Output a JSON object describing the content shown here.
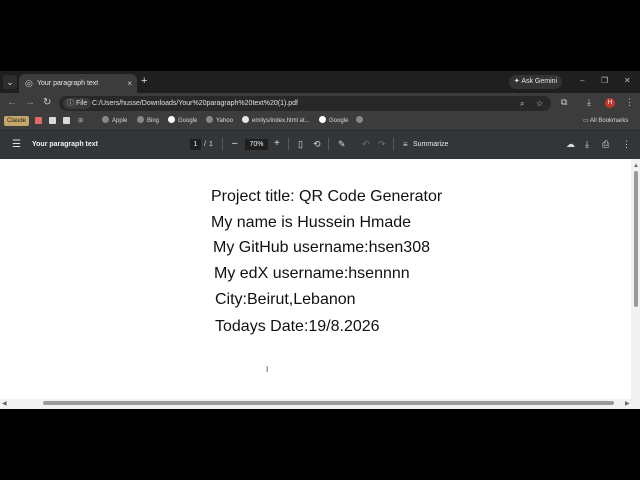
{
  "tabstrip": {
    "tab_title": "Your paragraph text",
    "close_glyph": "×",
    "new_tab_glyph": "+",
    "gemini_label": "Ask Gemini",
    "window_controls": [
      "–",
      "❐",
      "✕"
    ]
  },
  "toolbar": {
    "back_glyph": "←",
    "forward_glyph": "→",
    "reload_glyph": "↻",
    "file_chip": "File",
    "url": "C:/Users/husse/Downloads/Your%20paragraph%20text%20(1).pdf",
    "profile_initial": "H"
  },
  "bookmarks": {
    "claude": "Claude",
    "items": [
      {
        "label": "Apple",
        "icon": "apple-icon"
      },
      {
        "label": "Bing",
        "icon": "bing-icon"
      },
      {
        "label": "Google",
        "icon": "google-icon"
      },
      {
        "label": "Yahoo",
        "icon": "globe-icon"
      },
      {
        "label": "emilys/index.html at...",
        "icon": "github-icon"
      },
      {
        "label": "Google",
        "icon": "google-icon"
      }
    ],
    "all_bookmarks": "All Bookmarks"
  },
  "pdf_toolbar": {
    "title": "Your paragraph text",
    "page_current": "1",
    "page_sep": "/",
    "page_total": "1",
    "zoom_out": "–",
    "zoom_level": "70%",
    "zoom_in": "+",
    "summarize": "Summarize"
  },
  "document": {
    "lines": [
      "Project title: QR Code Generator",
      "My name is Hussein Hmade",
      "My GitHub username:hsen308",
      "My edX username:hsennnn",
      "City:Beirut,Lebanon",
      "Todays Date:19/8.2026"
    ]
  },
  "colors": {
    "chrome_dark": "#1f1f1f",
    "toolbar": "#3c3c3c",
    "pdf_toolbar": "#323639",
    "page": "#ffffff",
    "profile": "#c0392b"
  }
}
